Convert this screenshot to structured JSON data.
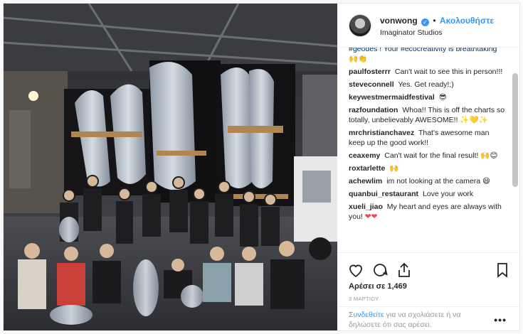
{
  "header": {
    "username": "vonwong",
    "verified_mark": "✓",
    "separator": "•",
    "follow_label": "Ακολουθήστε",
    "location": "Imaginator Studios"
  },
  "comments": [
    {
      "user": "",
      "text": "#geodes ! Your #ecocreativity is breathtaking",
      "emoji": "🙌👏"
    },
    {
      "user": "paulfosterrr",
      "text": "Can't wait to see this in person!!!",
      "emoji": ""
    },
    {
      "user": "steveconnell",
      "text": "Yes. Get ready!;)",
      "emoji": ""
    },
    {
      "user": "keywestmermaidfestival",
      "text": "",
      "emoji": "😎"
    },
    {
      "user": "razfoundation",
      "text": "Whoa!! This is off the charts so totally, unbelievably AWESOME!!",
      "emoji": "✨💛✨"
    },
    {
      "user": "mrchristianchavez",
      "text": "That's awesome man keep up the good work!!",
      "emoji": ""
    },
    {
      "user": "ceaxemy",
      "text": "Can't wait for the final result!",
      "emoji": "🙌😊"
    },
    {
      "user": "roxtarlette",
      "text": "",
      "emoji": "🙌"
    },
    {
      "user": "achewlim",
      "text": "im not looking at the camera",
      "emoji": "😄"
    },
    {
      "user": "quanbui_restaurant",
      "text": "Love your work",
      "emoji": ""
    },
    {
      "user": "xueli_jiao",
      "text": "My heart and eyes are always with you!",
      "emoji": "❤❤"
    }
  ],
  "actions": {
    "like_icon": "heart-icon",
    "comment_icon": "comment-icon",
    "share_icon": "share-icon",
    "save_icon": "bookmark-icon",
    "likes_label": "Αρέσει σε 1,469",
    "date": "3 ΜΑΡΤΙΟΥ"
  },
  "login": {
    "link": "Συνδεθείτε",
    "text": " για να σχολιάσετε ή να δηλώσετε ότι σας αρέσει.",
    "more_label": "•••"
  },
  "colors": {
    "accent": "#3897f0",
    "hashtag": "#003569",
    "meta": "#999999"
  }
}
